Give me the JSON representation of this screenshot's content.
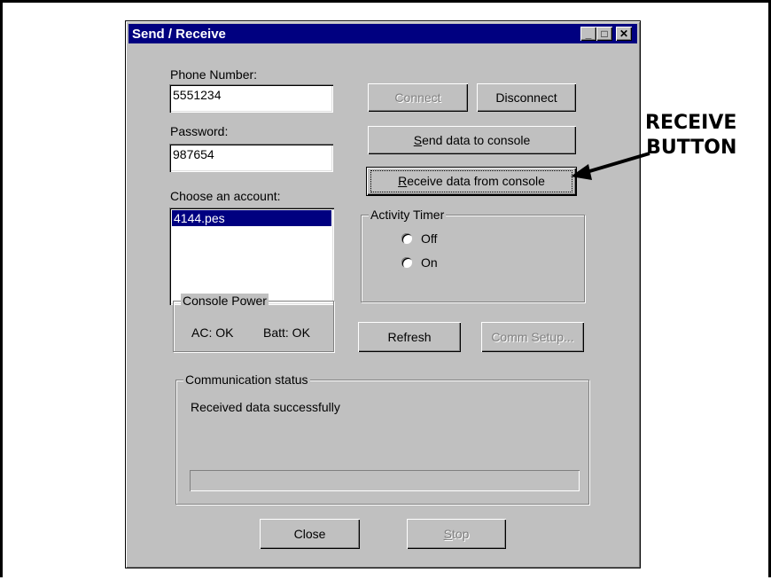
{
  "window": {
    "title": "Send / Receive",
    "minimize_glyph": "_",
    "maximize_glyph": "□",
    "close_glyph": "✕"
  },
  "fields": {
    "phone_label": "Phone Number:",
    "phone_value": "5551234",
    "password_label": "Password:",
    "password_value": "987654",
    "account_label": "Choose an account:",
    "accounts": [
      "4144.pes"
    ]
  },
  "buttons": {
    "connect": "Connect",
    "disconnect": "Disconnect",
    "send_prefix": "",
    "send_underline": "S",
    "send_rest": "end data to console",
    "receive_underline": "R",
    "receive_rest": "eceive data from console",
    "refresh": "Refresh",
    "comm_setup": "Comm Setup...",
    "close": "Close",
    "stop_underline": "S",
    "stop_rest": "top"
  },
  "activity_timer": {
    "title": "Activity Timer",
    "off_label": "Off",
    "on_label": "On"
  },
  "console_power": {
    "title": "Console Power",
    "ac": "AC: OK",
    "batt": "Batt: OK"
  },
  "communication": {
    "title": "Communication status",
    "status_text": "Received data successfully",
    "progress": 0
  },
  "annotation": {
    "line1": "RECEIVE",
    "line2": "BUTTON"
  }
}
